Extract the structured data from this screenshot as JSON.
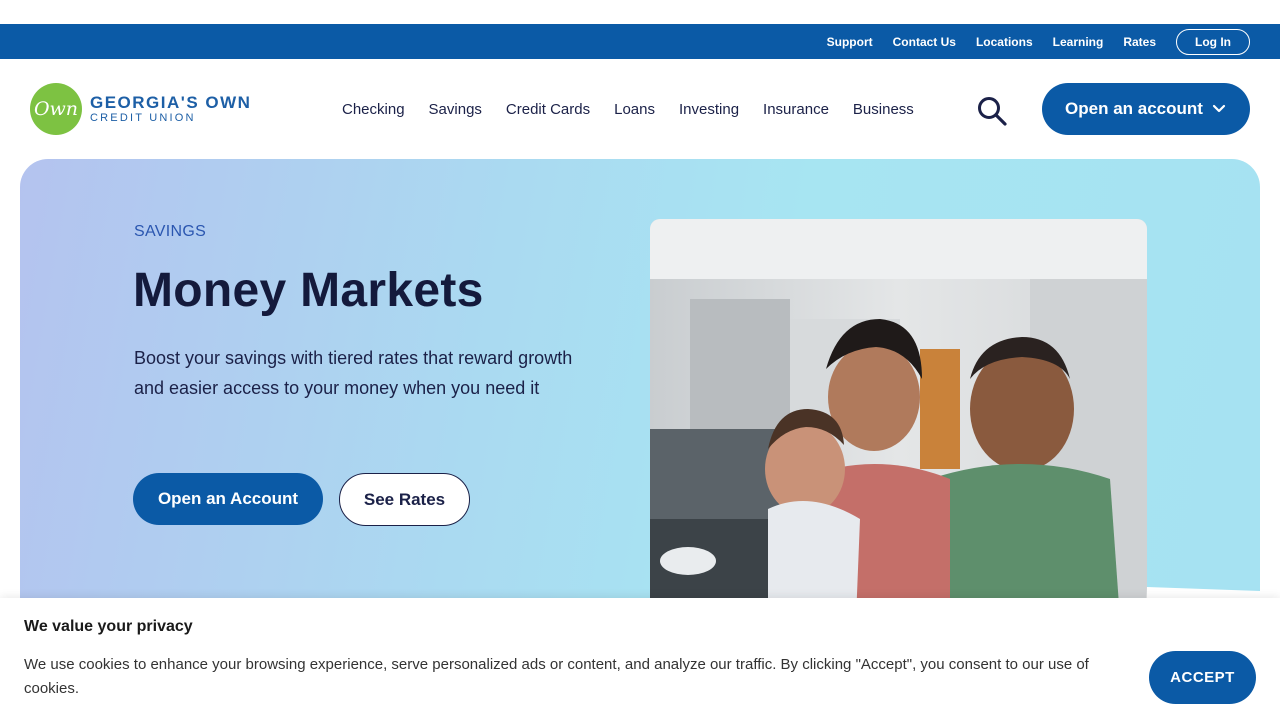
{
  "utility_nav": {
    "links": [
      "Support",
      "Contact Us",
      "Locations",
      "Learning",
      "Rates"
    ],
    "login_label": "Log In"
  },
  "brand": {
    "logo_mark": "Own",
    "name_line1": "GEORGIA'S OWN",
    "name_line2": "CREDIT UNION"
  },
  "main_nav": {
    "links": [
      "Checking",
      "Savings",
      "Credit Cards",
      "Loans",
      "Investing",
      "Insurance",
      "Business"
    ],
    "search_icon": "search-icon",
    "open_account_label": "Open an account"
  },
  "hero": {
    "eyebrow": "SAVINGS",
    "title": "Money Markets",
    "description": "Boost your savings with tiered rates that reward growth and easier access to your money when you need it",
    "primary_button": "Open an Account",
    "secondary_button": "See Rates"
  },
  "cookie_banner": {
    "title": "We value your privacy",
    "text": "We use cookies to enhance your browsing experience, serve personalized ads or content, and analyze our traffic. By clicking \"Accept\", you consent to our use of cookies.",
    "accept_label": "ACCEPT"
  },
  "colors": {
    "brand_blue": "#0b5aa6",
    "logo_green": "#7dc242",
    "heading_navy": "#141a3c"
  }
}
